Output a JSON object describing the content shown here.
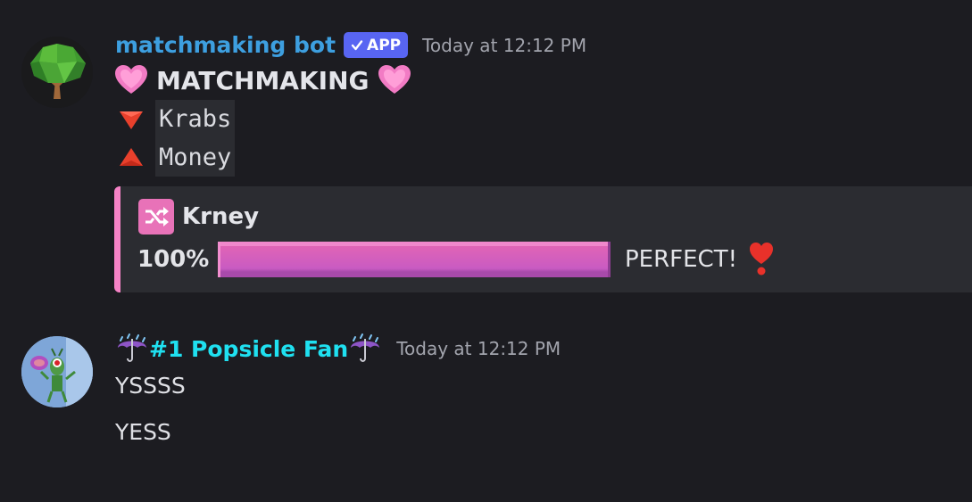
{
  "messages": [
    {
      "author": "matchmaking bot",
      "author_color": "#3d9fe0",
      "badge": "APP",
      "timestamp": "Today at 12:12 PM",
      "avatar_icon": "tree-icon",
      "lines": {
        "title_emoji": "pink-heart-icon",
        "title": "MATCHMAKING",
        "name1_icon": "red-triangle-down-icon",
        "name1": "Krabs",
        "name2_icon": "red-triangle-up-icon",
        "name2": "Money"
      },
      "embed": {
        "accent": "#f582c6",
        "icon": "shuffle-icon",
        "title": "Krney",
        "percent": "100%",
        "progress": 1.0,
        "result": "PERFECT!",
        "result_icon": "heart-exclamation-icon"
      }
    },
    {
      "author": "#1 Popsicle Fan",
      "author_color": "#1fe0f0",
      "timestamp": "Today at 12:12 PM",
      "avatar_icon": "plankton-avatar-icon",
      "name_decoration_icon": "umbrella-rain-icon",
      "lines": [
        "YSSSS",
        "YESS"
      ]
    }
  ]
}
